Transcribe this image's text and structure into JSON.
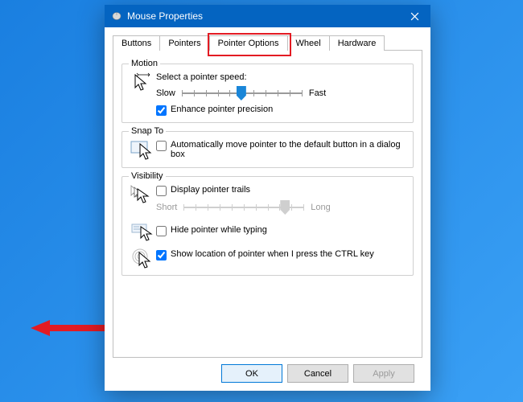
{
  "window": {
    "title": "Mouse Properties"
  },
  "tabs": [
    "Buttons",
    "Pointers",
    "Pointer Options",
    "Wheel",
    "Hardware"
  ],
  "activeTab": 2,
  "motion": {
    "legend": "Motion",
    "label": "Select a pointer speed:",
    "slow": "Slow",
    "fast": "Fast",
    "enhance": "Enhance pointer precision",
    "enhanceChecked": true
  },
  "snap": {
    "legend": "Snap To",
    "label": "Automatically move pointer to the default button in a dialog box",
    "checked": false
  },
  "visibility": {
    "legend": "Visibility",
    "trails": "Display pointer trails",
    "trailsChecked": false,
    "short": "Short",
    "long": "Long",
    "hide": "Hide pointer while typing",
    "hideChecked": false,
    "ctrl": "Show location of pointer when I press the CTRL key",
    "ctrlChecked": true
  },
  "buttons": {
    "ok": "OK",
    "cancel": "Cancel",
    "apply": "Apply"
  }
}
